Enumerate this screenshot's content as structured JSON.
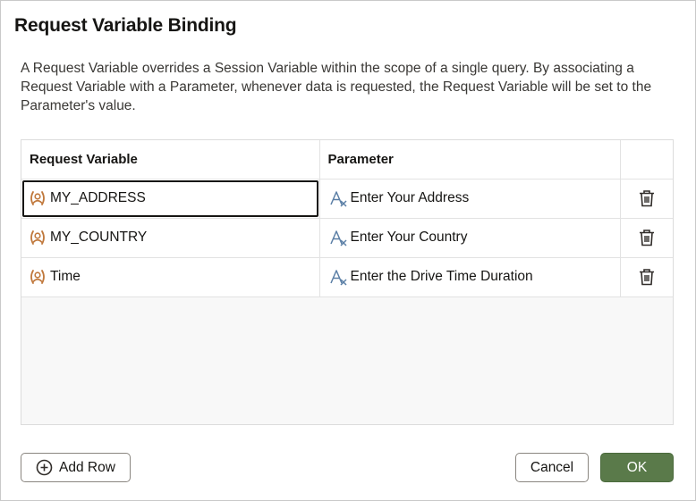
{
  "dialog": {
    "title": "Request Variable Binding",
    "description": "A Request Variable overrides a Session Variable within the scope of a single query. By associating a Request Variable with a Parameter, whenever data is requested, the Request Variable will be set to the Parameter's value."
  },
  "table": {
    "headers": {
      "request_variable": "Request Variable",
      "parameter": "Parameter"
    },
    "rows": [
      {
        "variable": "MY_ADDRESS",
        "parameter": "Enter Your Address",
        "focused": true
      },
      {
        "variable": "MY_COUNTRY",
        "parameter": "Enter Your Country",
        "focused": false
      },
      {
        "variable": "Time",
        "parameter": "Enter the Drive Time Duration",
        "focused": false
      }
    ]
  },
  "icons": {
    "variable": "request-variable-icon",
    "parameter": "parameter-icon",
    "delete": "trash-icon",
    "add": "plus-circle-icon"
  },
  "buttons": {
    "add_row": "Add Row",
    "cancel": "Cancel",
    "ok": "OK"
  },
  "colors": {
    "variable_icon": "#c0783c",
    "parameter_icon": "#5b7fa6",
    "ok_button": "#5a7a4a"
  }
}
